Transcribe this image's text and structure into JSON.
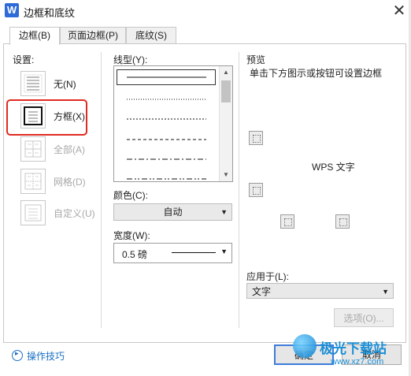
{
  "window": {
    "title": "边框和底纹",
    "app_icon": "W",
    "close_glyph": "✕"
  },
  "tabs": [
    {
      "label": "边框(B)",
      "active": true
    },
    {
      "label": "页面边框(P)",
      "active": false
    },
    {
      "label": "底纹(S)",
      "active": false
    }
  ],
  "settings": {
    "label": "设置:",
    "items": [
      {
        "label": "无(N)",
        "enabled": true
      },
      {
        "label": "方框(X)",
        "enabled": true,
        "highlighted": true
      },
      {
        "label": "全部(A)",
        "enabled": false
      },
      {
        "label": "网格(D)",
        "enabled": false
      },
      {
        "label": "自定义(U)",
        "enabled": false
      }
    ]
  },
  "line_style": {
    "label": "线型(Y):",
    "styles": [
      "solid",
      "dotted",
      "dashed-small",
      "dashed",
      "dash-dot",
      "dash-dot-dot"
    ],
    "selected_index": 0
  },
  "color": {
    "label": "颜色(C):",
    "value": "自动"
  },
  "width": {
    "label": "宽度(W):",
    "value": "0.5 磅"
  },
  "preview": {
    "label": "预览",
    "hint": "单击下方图示或按钮可设置边框",
    "sample_text": "WPS 文字"
  },
  "apply_to": {
    "label": "应用于(L):",
    "value": "文字"
  },
  "options_button": "选项(O)...",
  "tips_link": "操作技巧",
  "ok_button": "确定",
  "cancel_button": "取消",
  "watermark": {
    "brand": "极光下载站",
    "url": "www.xz7.com"
  },
  "colors": {
    "highlight": "#e02a20",
    "app_blue": "#2f6bd8",
    "link_blue": "#1a6fc4"
  }
}
